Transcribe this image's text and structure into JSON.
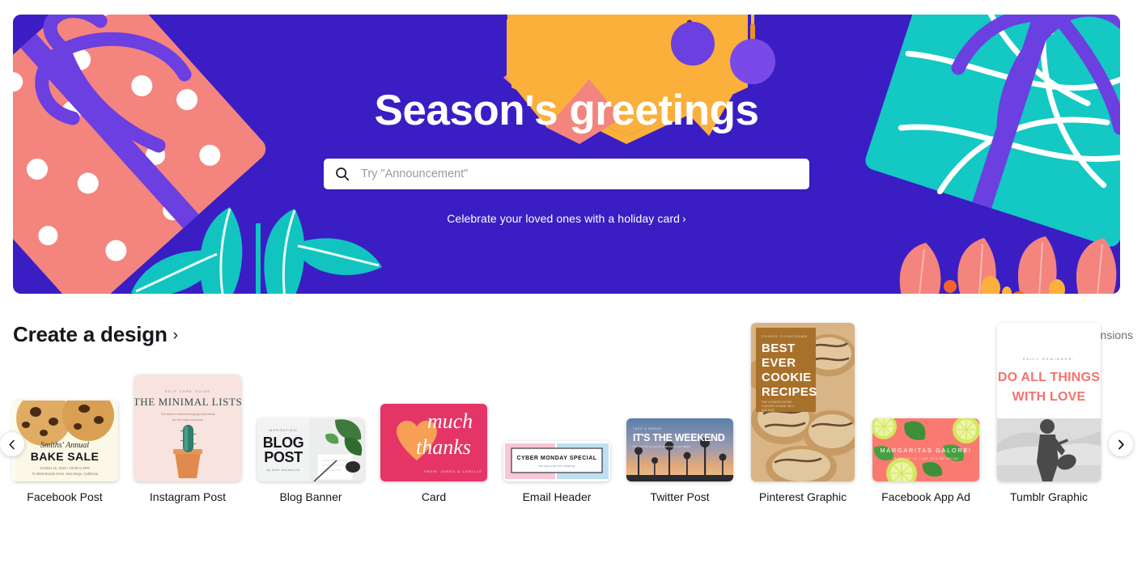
{
  "hero": {
    "title": "Season's greetings",
    "search": {
      "placeholder": "Try \"Announcement\"",
      "value": "",
      "icon": "search-icon"
    },
    "promo_link": "Celebrate your loved ones with a holiday card",
    "promo_chevron": "›",
    "colors": {
      "background": "#3a1ec4",
      "gift_pink": "#f4847e",
      "gift_teal": "#14c8c3",
      "ribbon_purple": "#6b3fe0",
      "star_orange": "#fbb03b",
      "star_pink": "#f4847e",
      "leaf_teal": "#12c4c0"
    }
  },
  "section": {
    "title": "Create a design",
    "title_chevron": "›",
    "custom_dimensions": "Custom dimensions"
  },
  "carousel": {
    "prev_label": "‹",
    "next_label": "›",
    "cards": [
      {
        "label": "Facebook Post",
        "artwork": "facebook-post-bake-sale",
        "lines": [
          "Smiths' Annual",
          "BAKE SALE",
          "October 15, 2019  •  10AM to 4PM",
          "72 West Bracks Drive, San Diego, California"
        ]
      },
      {
        "label": "Instagram Post",
        "artwork": "instagram-post-minimal-lists",
        "lines": [
          "SELF CARE GUIDE",
          "THE MINIMAL LISTS",
          "The best in minimal living tips and ideas for the home and work"
        ]
      },
      {
        "label": "Blog Banner",
        "artwork": "blog-banner-plants",
        "lines": [
          "INSPIRATION!",
          "BLOG",
          "POST",
          "by beth duckworth"
        ]
      },
      {
        "label": "Card",
        "artwork": "card-much-thanks",
        "lines": [
          "much",
          "thanks",
          "FROM: JAMES & CAMILLE"
        ]
      },
      {
        "label": "Email Header",
        "artwork": "email-header-cyber-monday",
        "lines": [
          "CYBER MONDAY SPECIAL",
          "last day to get free shipping!"
        ]
      },
      {
        "label": "Twitter Post",
        "artwork": "twitter-post-weekend",
        "lines": [
          "TAKE A BREAK",
          "IT'S THE WEEKEND",
          "Put your feet up and do what makes you happy"
        ]
      },
      {
        "label": "Pinterest Graphic",
        "artwork": "pinterest-cookie-recipes",
        "lines": [
          "COOKIE COUNTDOWN",
          "BEST",
          "EVER",
          "COOKIE",
          "RECIPES",
          "THE ULTIMATE COOKIE FLAVORS TO BAKE, SELL, AND GIVE"
        ]
      },
      {
        "label": "Facebook App Ad",
        "artwork": "facebook-app-ad-margaritas",
        "lines": [
          "MARGARITAS GALORE!",
          "FEBRUARY 22  10AM  JOIN US ONLINE"
        ]
      },
      {
        "label": "Tumblr Graphic",
        "artwork": "tumblr-do-all-things",
        "lines": [
          "DAILY REMINDER:",
          "DO ALL THINGS",
          "WITH LOVE"
        ]
      }
    ]
  }
}
